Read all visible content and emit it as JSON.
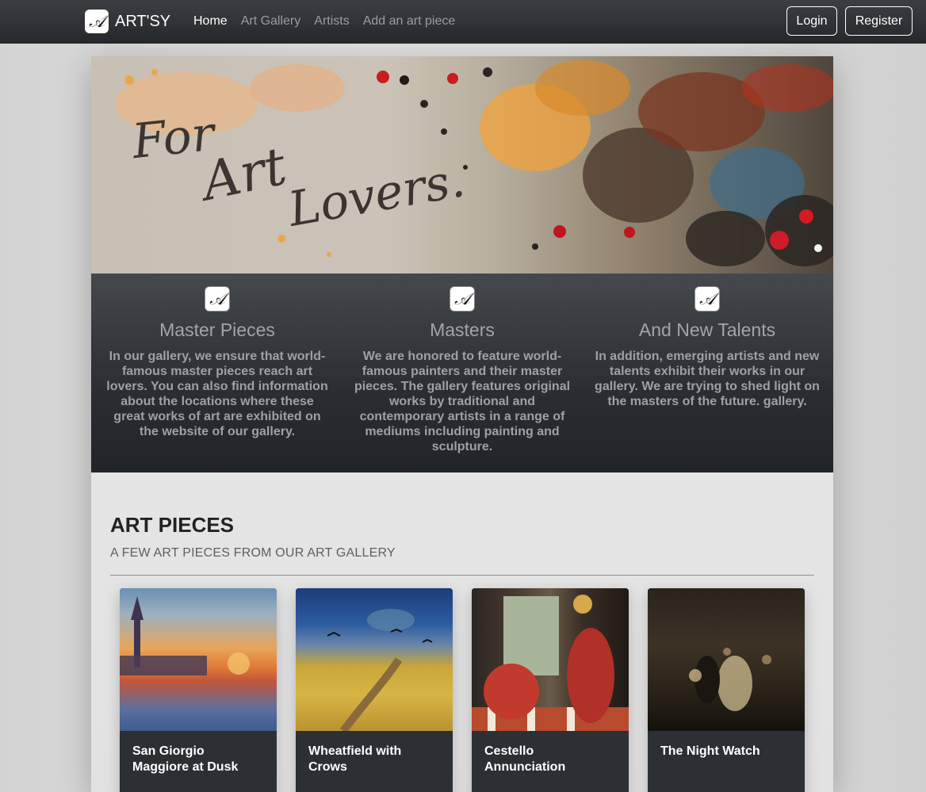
{
  "navbar": {
    "brand_logo": "𝒜",
    "brand_name": "ART'SY",
    "links": [
      {
        "label": "Home",
        "active": true
      },
      {
        "label": "Art Gallery",
        "active": false
      },
      {
        "label": "Artists",
        "active": false
      },
      {
        "label": "Add an art piece",
        "active": false
      }
    ],
    "login_label": "Login",
    "register_label": "Register"
  },
  "hero": {
    "line1": "For",
    "line2": "Art",
    "line3": "Lovers."
  },
  "features": [
    {
      "icon": "𝒜",
      "title": "Master Pieces",
      "text": "In our gallery, we ensure that world-famous master pieces reach art lovers. You can also find information about the locations where these great works of art are exhibited on the website of our gallery."
    },
    {
      "icon": "𝒜",
      "title": "Masters",
      "text": "We are honored to feature world-famous painters and their master pieces. The gallery features original works by traditional and contemporary artists in a range of mediums including painting and sculpture."
    },
    {
      "icon": "𝒜",
      "title": "And New Talents",
      "text": "In addition, emerging artists and new talents exhibit their works in our gallery. We are trying to shed light on the masters of the future. gallery."
    }
  ],
  "art_section": {
    "title": "ART PIECES",
    "subtitle": "A FEW ART PIECES FROM OUR ART GALLERY",
    "cards": [
      {
        "title": "San Giorgio Maggiore at Dusk"
      },
      {
        "title": "Wheatfield with Crows"
      },
      {
        "title": "Cestello Annunciation"
      },
      {
        "title": "The Night Watch"
      }
    ]
  },
  "colors": {
    "navbar": "#2b2e32",
    "feature_panel": "#2a2d31",
    "card_body": "#2c2f33",
    "text_light": "#ffffff"
  }
}
